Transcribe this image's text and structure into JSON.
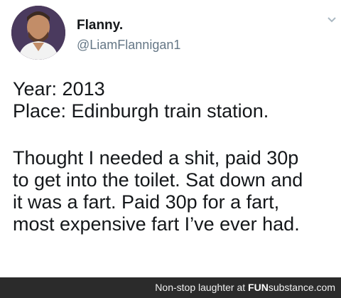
{
  "tweet": {
    "display_name": "Flanny.",
    "handle": "@LiamFlannigan1",
    "more_icon": "chevron-down-icon",
    "lines": [
      "Year: 2013",
      "Place: Edinburgh train station.",
      "Thought I needed a shit, paid 30p",
      "to get into the toilet. Sat down and",
      "it was a fart. Paid 30p for a fart,",
      "most expensive fart I’ve ever had."
    ]
  },
  "watermark": {
    "prefix": "Non-stop laughter at",
    "brand_bold": "FUN",
    "brand_rest": "substance",
    "suffix": ".com"
  }
}
